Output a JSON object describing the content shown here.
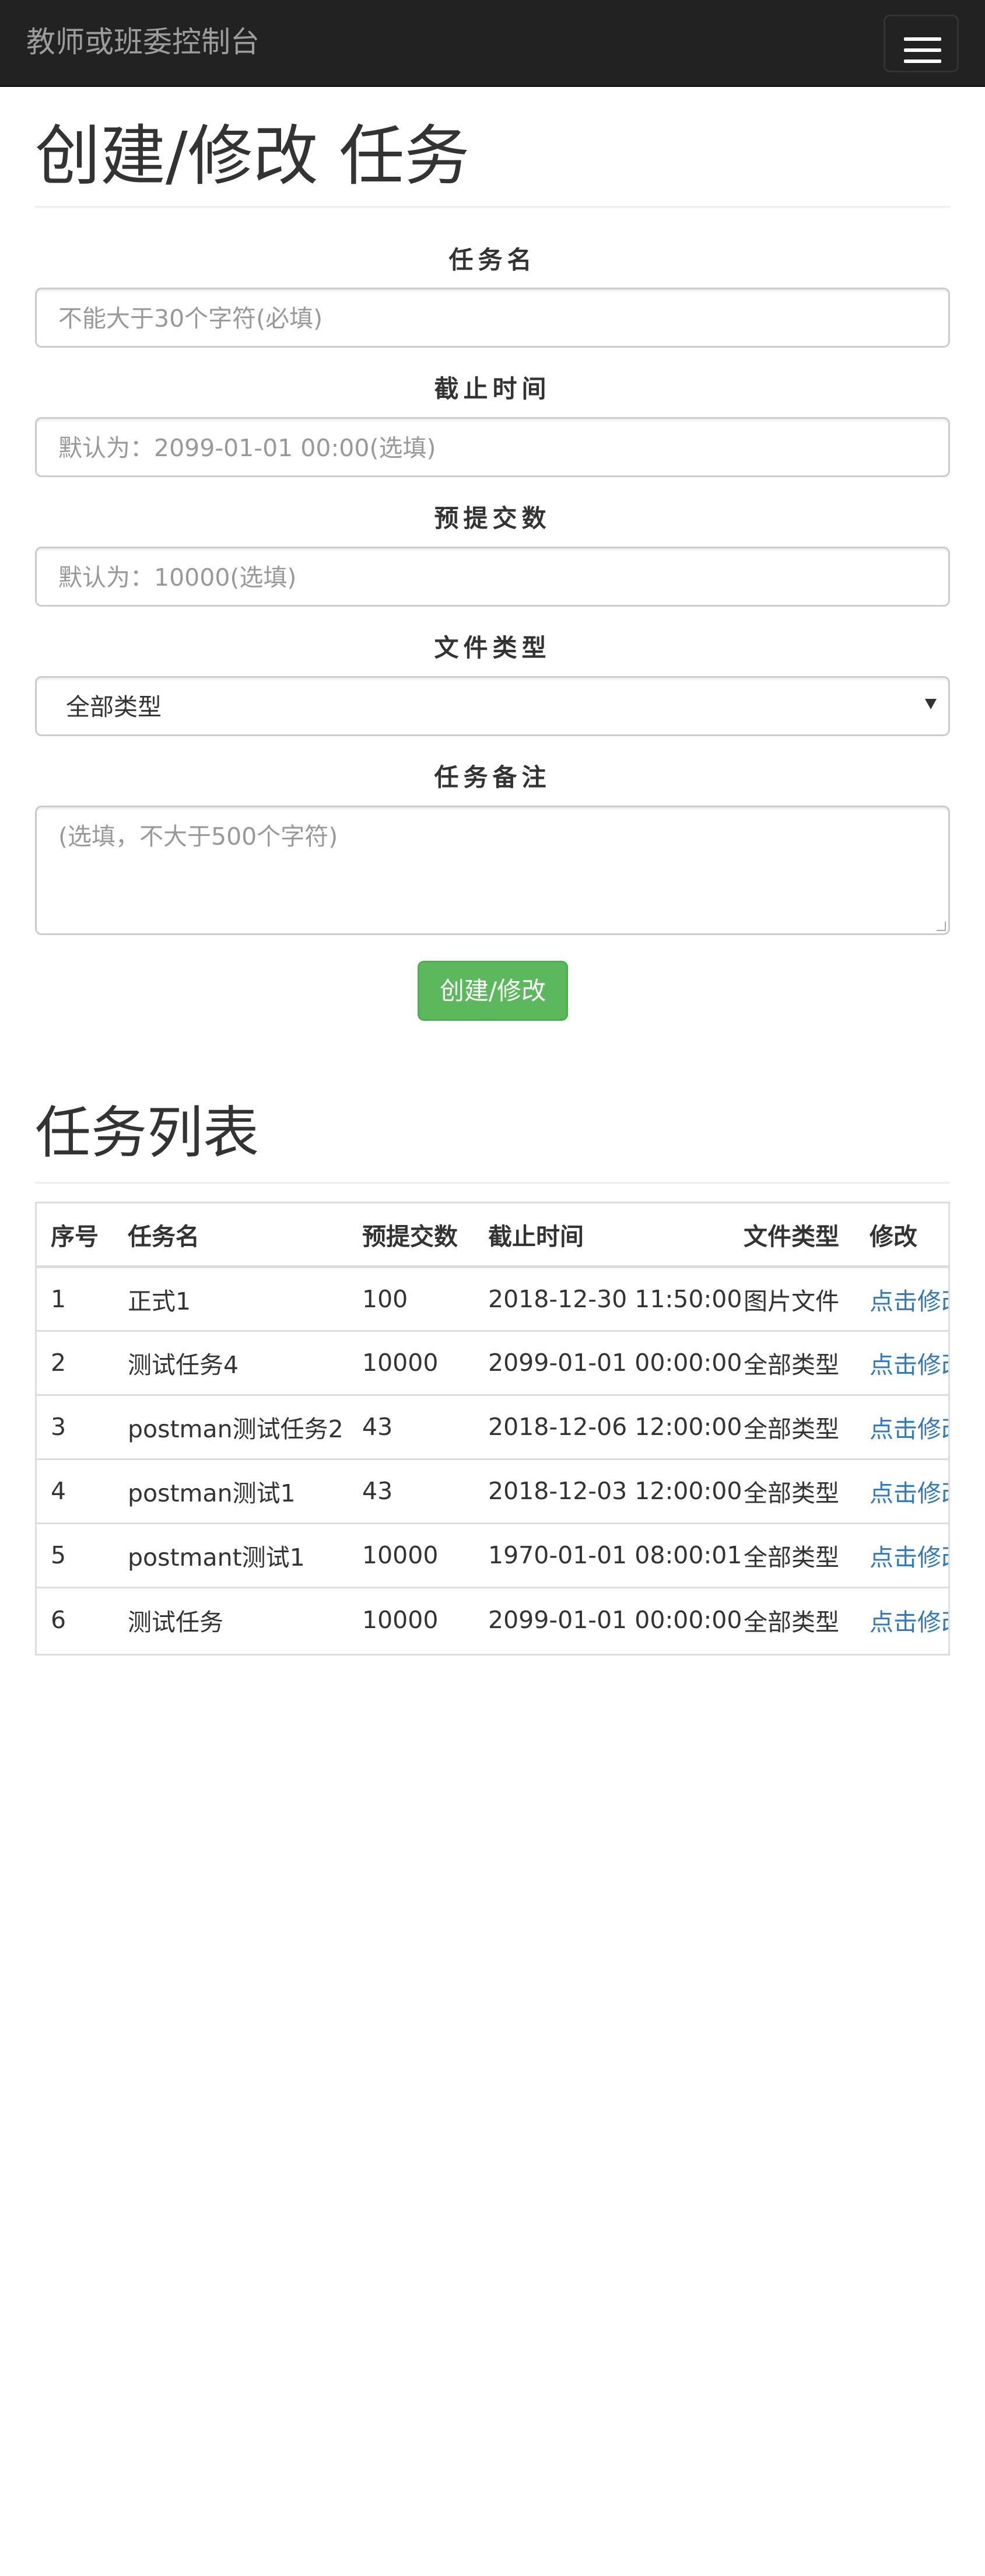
{
  "navbar": {
    "brand": "教师或班委控制台",
    "toggle_icon": "hamburger-menu-icon"
  },
  "form": {
    "title": "创建/修改 任务",
    "task_name": {
      "label": "任务名",
      "placeholder": "不能大于30个字符(必填)"
    },
    "deadline": {
      "label": "截止时间",
      "placeholder": "默认为：2099-01-01 00:00(选填)"
    },
    "expected_count": {
      "label": "预提交数",
      "placeholder": "默认为：10000(选填)"
    },
    "file_type": {
      "label": "文件类型",
      "selected": "全部类型"
    },
    "remark": {
      "label": "任务备注",
      "placeholder": "(选填，不大于500个字符)"
    },
    "submit_label": "创建/修改",
    "submit_color": "#5cb85c"
  },
  "task_list": {
    "title": "任务列表",
    "columns": [
      "序号",
      "任务名",
      "预提交数",
      "截止时间",
      "文件类型",
      "修改"
    ],
    "rows": [
      [
        "1",
        "正式1",
        "100",
        "2018-12-30 11:50:00",
        "图片文件",
        "点击修改"
      ],
      [
        "2",
        "测试任务4",
        "10000",
        "2099-01-01 00:00:00",
        "全部类型",
        "点击修改"
      ],
      [
        "3",
        "postman测试任务2",
        "43",
        "2018-12-06 12:00:00",
        "全部类型",
        "点击修改"
      ],
      [
        "4",
        "postman测试1",
        "43",
        "2018-12-03 12:00:00",
        "全部类型",
        "点击修改"
      ],
      [
        "5",
        "postmant测试1",
        "10000",
        "1970-01-01 08:00:01",
        "全部类型",
        "点击修改"
      ],
      [
        "6",
        "测试任务",
        "10000",
        "2099-01-01 00:00:00",
        "全部类型",
        "点击修改"
      ]
    ],
    "link_color": "#337ab7"
  }
}
